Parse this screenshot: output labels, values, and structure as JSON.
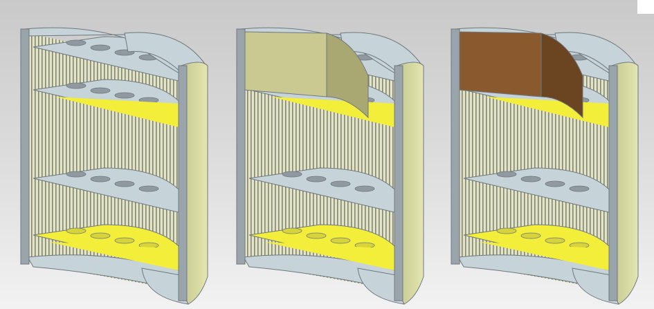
{
  "viewport": {
    "corner_patch_color": "#ffffff"
  },
  "models": [
    {
      "name": "cutaway-no-panel",
      "panel_color": null,
      "panel_shade": null
    },
    {
      "name": "cutaway-khaki-panel",
      "panel_color": "#c9c991",
      "panel_shade": "#a9a872"
    },
    {
      "name": "cutaway-brown-panel",
      "panel_color": "#8a5a2e",
      "panel_shade": "#6b4421"
    }
  ],
  "colors": {
    "frame": "#9aa4ab",
    "frame_dark": "#6e777d",
    "cap": "#c6d3d8",
    "skin": "#d6d89e",
    "stripe_light": "#e6e6c4",
    "stripe_dark": "#8e9488",
    "yellow": "#f2ee3a"
  }
}
